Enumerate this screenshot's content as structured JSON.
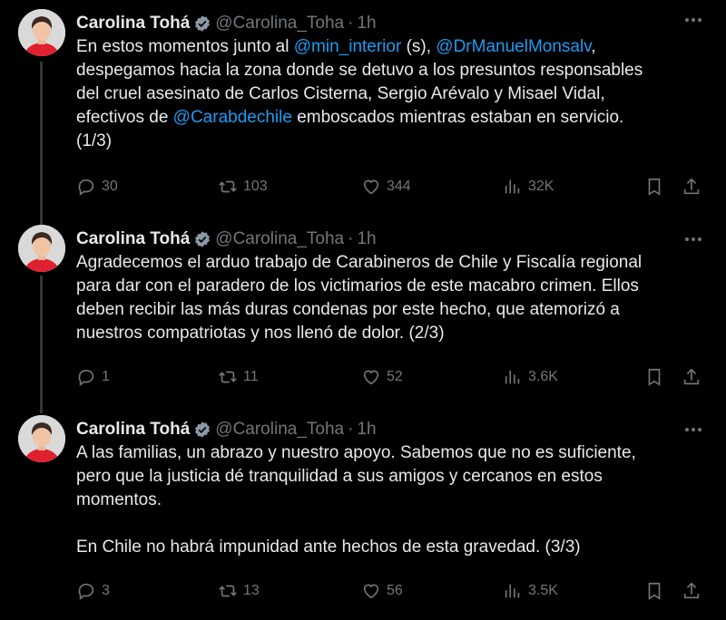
{
  "tweets": [
    {
      "name": "Carolina Tohá",
      "handle": "@Carolina_Toha",
      "dot": "·",
      "time": "1h",
      "body": [
        {
          "t": "En estos momentos junto al "
        },
        {
          "t": "@min_interior",
          "m": true
        },
        {
          "t": " (s), "
        },
        {
          "t": "@DrManuelMonsalv",
          "m": true
        },
        {
          "t": ",\ndespegamos hacia la zona donde se detuvo a los presuntos responsables\ndel cruel asesinato de Carlos Cisterna, Sergio Arévalo y Misael Vidal,\nefectivos de "
        },
        {
          "t": "@Carabdechile",
          "m": true
        },
        {
          "t": " emboscados mientras estaban en servicio.\n(1/3)"
        }
      ],
      "replies": "30",
      "reposts": "103",
      "likes": "344",
      "views": "32K"
    },
    {
      "name": "Carolina Tohá",
      "handle": "@Carolina_Toha",
      "dot": "·",
      "time": "1h",
      "body": [
        {
          "t": "Agradecemos el arduo trabajo de Carabineros de Chile y Fiscalía regional\npara dar con el paradero de los victimarios de este macabro crimen. Ellos\ndeben recibir las más duras condenas por este hecho, que atemorizó a\nnuestros compatriotas y nos llenó de dolor. (2/3)"
        }
      ],
      "replies": "1",
      "reposts": "11",
      "likes": "52",
      "views": "3.6K"
    },
    {
      "name": "Carolina Tohá",
      "handle": "@Carolina_Toha",
      "dot": "·",
      "time": "1h",
      "body": [
        {
          "t": "A las familias, un abrazo y nuestro apoyo. Sabemos que no es suficiente,\npero que la justicia dé tranquilidad a sus amigos y cercanos en estos\nmomentos.\n\nEn Chile no habrá impunidad ante hechos de esta gravedad. (3/3)"
        }
      ],
      "replies": "3",
      "reposts": "13",
      "likes": "56",
      "views": "3.5K"
    }
  ],
  "icons": {
    "verified": "verified-badge-icon",
    "more": "more-dots-icon",
    "reply": "reply-bubble-icon",
    "repost": "repost-arrows-icon",
    "like": "heart-icon",
    "views": "views-bars-icon",
    "bookmark": "bookmark-icon",
    "share": "share-upload-icon"
  },
  "colors": {
    "background": "#000000",
    "text": "#e7e9ea",
    "muted": "#71767b",
    "link": "#1d9bf0",
    "avatar_red": "#e0202e"
  }
}
